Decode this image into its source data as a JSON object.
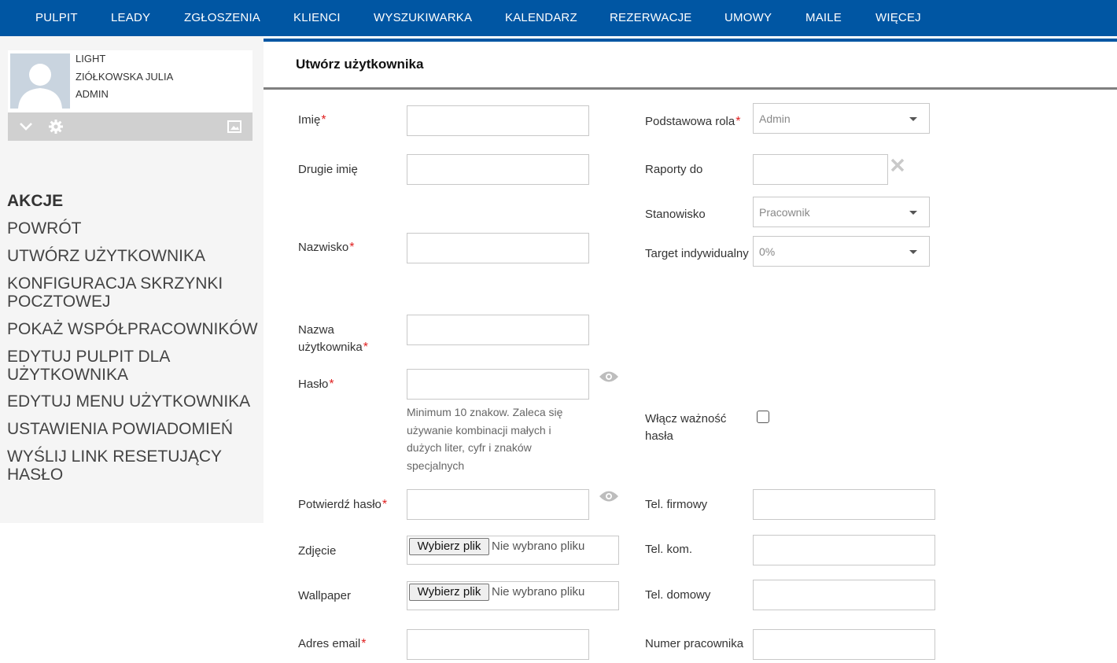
{
  "nav": [
    "PULPIT",
    "LEADY",
    "ZGŁOSZENIA",
    "KLIENCI",
    "WYSZUKIWARKA",
    "KALENDARZ",
    "REZERWACJE",
    "UMOWY",
    "MAILE",
    "WIĘCEJ"
  ],
  "profile": {
    "line1": "LIGHT",
    "line2": "ZIÓŁKOWSKA JULIA",
    "line3": "ADMIN"
  },
  "sidebar": {
    "title": "AKCJE",
    "items": [
      "POWRÓT",
      "UTWÓRZ UŻYTKOWNIKA",
      "KONFIGURACJA SKRZYNKI POCZTOWEJ",
      "POKAŻ WSPÓŁPRACOWNIKÓW",
      "EDYTUJ PULPIT DLA UŻYTKOWNIKA",
      "EDYTUJ MENU UŻYTKOWNIKA",
      "USTAWIENIA POWIADOMIEŃ",
      "WYŚLIJ LINK RESETUJĄCY HASŁO"
    ]
  },
  "form": {
    "title": "Utwórz użytkownika",
    "required_mark": "*",
    "first_name": "Imię",
    "middle_name": "Drugie imię",
    "last_name": "Nazwisko",
    "username": "Nazwa użytkownika",
    "password": "Hasło",
    "password_hint": "Minimum 10 znakow. Zaleca się używanie kombinacji małych i dużych liter, cyfr i znaków specjalnych",
    "confirm_password": "Potwierdź hasło",
    "photo": "Zdjęcie",
    "wallpaper": "Wallpaper",
    "email": "Adres email",
    "file_button": "Wybierz plik",
    "file_none": "Nie wybrano pliku",
    "base_role": "Podstawowa rola",
    "base_role_value": "Admin",
    "reports_to": "Raporty do",
    "position": "Stanowisko",
    "position_value": "Pracownik",
    "target": "Target indywidualny",
    "target_value": "0%",
    "password_expiry": "Włącz ważność hasła",
    "company_phone": "Tel. firmowy",
    "mobile_phone": "Tel. kom.",
    "home_phone": "Tel. domowy",
    "employee_number": "Numer pracownika"
  }
}
